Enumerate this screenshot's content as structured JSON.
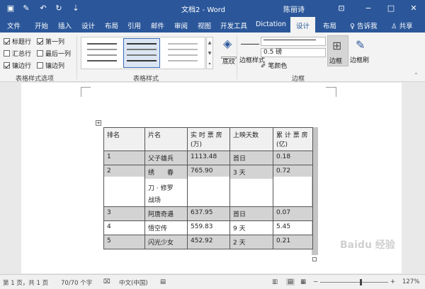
{
  "titlebar": {
    "doc_title": "文档2 - Word",
    "user": "陈丽诗",
    "icons": [
      "save-icon",
      "touch-mode-icon",
      "undo-icon",
      "redo-icon",
      "customize-qat-icon"
    ]
  },
  "tabs": [
    "文件",
    "开始",
    "插入",
    "设计",
    "布局",
    "引用",
    "邮件",
    "审阅",
    "视图",
    "开发工具",
    "Dictation",
    "设计",
    "布局"
  ],
  "tell_me": "告诉我",
  "share": "共享",
  "ribbon": {
    "style_options": {
      "checkboxes": [
        {
          "label": "标题行",
          "checked": true
        },
        {
          "label": "第一列",
          "checked": true
        },
        {
          "label": "汇总行",
          "checked": false
        },
        {
          "label": "最后一列",
          "checked": false
        },
        {
          "label": "镶边行",
          "checked": true
        },
        {
          "label": "镶边列",
          "checked": false
        }
      ],
      "group_label": "表格样式选项"
    },
    "table_styles_label": "表格样式",
    "shading_label": "底纹",
    "border_styles_label": "边框样式",
    "pen_weight": "0.5 磅",
    "pen_color_label": "笔颜色",
    "borders_label": "边框",
    "border_painter_label": "边框刷",
    "borders_group_label": "边框"
  },
  "table": {
    "headers": [
      [
        "排名",
        ""
      ],
      [
        "片名",
        ""
      ],
      [
        "实 时 票 房",
        "(万)"
      ],
      [
        "上映天数",
        ""
      ],
      [
        "累 计 票 房",
        "(亿)"
      ]
    ],
    "rows": [
      {
        "cells": [
          [
            "1"
          ],
          [
            "父子雄兵"
          ],
          [
            "1113.48"
          ],
          [
            "首日"
          ],
          [
            "0.18"
          ]
        ],
        "shaded": true
      },
      {
        "cells": [
          [
            "2"
          ],
          [
            "绣　　春",
            "刀 · 修罗",
            "战场"
          ],
          [
            "765.90"
          ],
          [
            "3 天"
          ],
          [
            "0.72"
          ]
        ],
        "shaded": false
      },
      {
        "cells": [
          [
            "3"
          ],
          [
            "阿唐奇遇"
          ],
          [
            "637.95"
          ],
          [
            "首日"
          ],
          [
            "0.07"
          ]
        ],
        "shaded": true
      },
      {
        "cells": [
          [
            "4"
          ],
          [
            "悟空传"
          ],
          [
            "559.83"
          ],
          [
            "9 天"
          ],
          [
            "5.45"
          ]
        ],
        "shaded": false
      },
      {
        "cells": [
          [
            "5"
          ],
          [
            "闪光少女"
          ],
          [
            "452.92"
          ],
          [
            "2 天"
          ],
          [
            "0.21"
          ]
        ],
        "shaded": true
      }
    ]
  },
  "status": {
    "page": "第 1 页，共 1 页",
    "words": "70/70 个字",
    "language": "中文(中国)",
    "zoom": "127%"
  },
  "watermark": "Baidu 经验"
}
